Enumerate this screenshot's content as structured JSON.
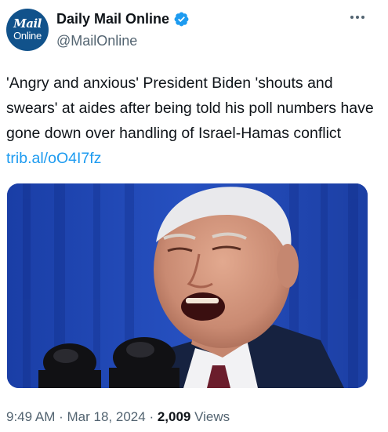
{
  "account": {
    "avatar_line1": "Mail",
    "avatar_line2": "Online",
    "display_name": "Daily Mail Online",
    "handle": "@MailOnline"
  },
  "tweet": {
    "text": "'Angry and anxious' President Biden 'shouts and swears' at aides after being told his poll numbers have gone down over handling of Israel-Hamas conflict",
    "link": "trib.al/oO4I7fz"
  },
  "meta": {
    "time": "9:49 AM",
    "separator": "·",
    "date": "Mar 18, 2024",
    "views_count": "2,009",
    "views_label": "Views"
  },
  "colors": {
    "link": "#1d9bf0",
    "verified": "#1d9bf0",
    "secondary_text": "#536471",
    "avatar_bg": "#11528b"
  },
  "icons": {
    "verified": "verified-badge-icon",
    "more": "more-options-icon"
  }
}
